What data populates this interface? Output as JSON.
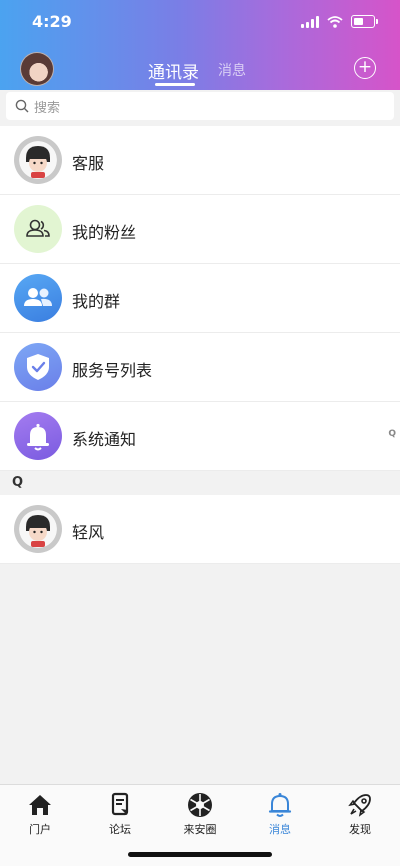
{
  "status_bar": {
    "time": "4:29"
  },
  "header": {
    "tab_active": "通讯录",
    "tab_inactive": "消息"
  },
  "search": {
    "placeholder": "搜索"
  },
  "contacts": [
    {
      "label": "客服",
      "icon": "avatar"
    },
    {
      "label": "我的粉丝",
      "icon": "fans-icon"
    },
    {
      "label": "我的群",
      "icon": "group-icon"
    },
    {
      "label": "服务号列表",
      "icon": "shield-check-icon"
    },
    {
      "label": "系统通知",
      "icon": "bell-icon"
    }
  ],
  "index_letter": "Q",
  "sections": [
    {
      "letter": "Q",
      "items": [
        {
          "label": "轻风",
          "icon": "avatar"
        }
      ]
    }
  ],
  "bottom_nav": [
    {
      "label": "门户",
      "icon": "home-icon"
    },
    {
      "label": "论坛",
      "icon": "forum-icon"
    },
    {
      "label": "来安圈",
      "icon": "aperture-icon"
    },
    {
      "label": "消息",
      "icon": "bell-icon",
      "active": true
    },
    {
      "label": "发现",
      "icon": "rocket-icon"
    }
  ],
  "colors": {
    "active_nav": "#3a86d8",
    "header_start": "#4ba3f0",
    "header_end": "#d654c9"
  }
}
